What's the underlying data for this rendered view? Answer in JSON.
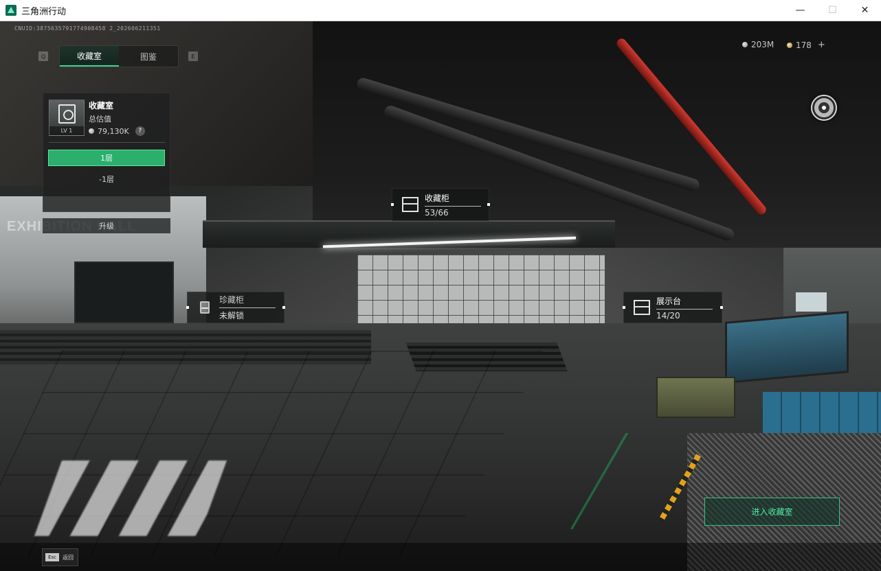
{
  "window": {
    "title": "三角洲行动",
    "minimize": "—",
    "maximize": "☐",
    "close": "✕"
  },
  "uid_text": "CNUID:3875635791774908458 2_202606211351",
  "tabs": {
    "prev_key": "Q",
    "next_key": "E",
    "items": [
      {
        "label": "收藏室",
        "active": true
      },
      {
        "label": "图鉴",
        "active": false
      }
    ]
  },
  "currency": {
    "silver": "203M",
    "gold": "178",
    "add": "+"
  },
  "collection": {
    "title": "收藏室",
    "level": "LV 1",
    "subtitle": "总估值",
    "value": "79,130K",
    "help": "?",
    "floors": [
      "1层",
      "-1层"
    ],
    "upgrade": "升级"
  },
  "hotspots": {
    "cabinet": {
      "title": "收藏柜",
      "value": "53/66"
    },
    "rare_cabinet": {
      "title": "珍藏柜",
      "value": "未解锁"
    },
    "display_stand": {
      "title": "展示台",
      "value": "14/20"
    }
  },
  "scene": {
    "hall_sign": "EXHIBITION HALL"
  },
  "enter_button": "进入收藏室",
  "esc": {
    "key": "Esc",
    "label": "返回"
  },
  "colors": {
    "accent_green": "#2cae6c",
    "accent_green_text": "#4fe8a4",
    "titlebar": "#ffffff"
  }
}
